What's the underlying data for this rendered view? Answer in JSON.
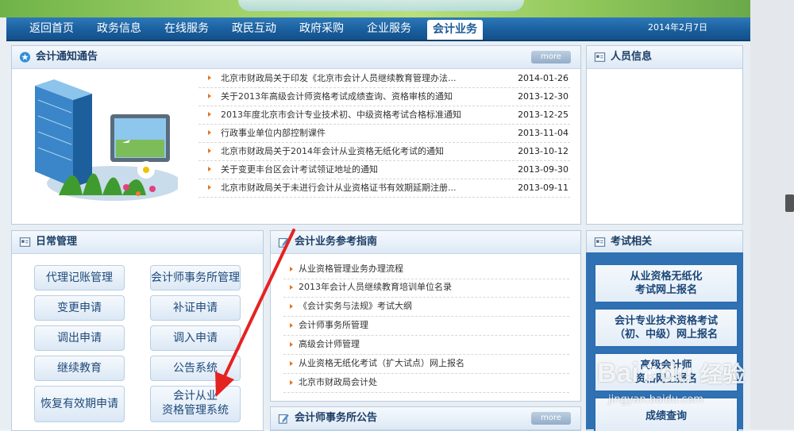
{
  "nav": {
    "items": [
      "返回首页",
      "政务信息",
      "在线服务",
      "政民互动",
      "政府采购",
      "企业服务",
      "会计业务"
    ],
    "active": "会计业务",
    "date": "2014年2月7日"
  },
  "notices": {
    "title": "会计通知通告",
    "more_label": "more",
    "items": [
      {
        "title": "北京市财政局关于印发《北京市会计人员继续教育管理办法...",
        "date": "2014-01-26"
      },
      {
        "title": "关于2013年高级会计师资格考试成绩查询、资格审核的通知",
        "date": "2013-12-30"
      },
      {
        "title": "2013年度北京市会计专业技术初、中级资格考试合格标准通知",
        "date": "2013-12-25"
      },
      {
        "title": "行政事业单位内部控制课件",
        "date": "2013-11-04"
      },
      {
        "title": "北京市财政局关于2014年会计从业资格无纸化考试的通知",
        "date": "2013-10-12"
      },
      {
        "title": "关于变更丰台区会计考试领证地址的通知",
        "date": "2013-09-30"
      },
      {
        "title": "北京市财政局关于未进行会计从业资格证书有效期延期注册...",
        "date": "2013-09-11"
      }
    ]
  },
  "personnel": {
    "title": "人员信息"
  },
  "daily": {
    "title": "日常管理",
    "buttons": [
      "代理记账管理",
      "会计师事务所管理",
      "变更申请",
      "补证申请",
      "调出申请",
      "调入申请",
      "继续教育",
      "公告系统",
      "恢复有效期申请",
      "会计从业",
      "资格管理系统"
    ]
  },
  "guide": {
    "title": "会计业务参考指南",
    "items": [
      "从业资格管理业务办理流程",
      "2013年会计人员继续教育培训单位名录",
      "《会计实务与法规》考试大纲",
      "会计师事务所管理",
      "高级会计师管理",
      "从业资格无纸化考试（扩大试点）网上报名",
      "北京市财政局会计处"
    ]
  },
  "firm_notices": {
    "title": "会计师事务所公告",
    "more_label": "more"
  },
  "exam": {
    "title": "考试相关",
    "blocks": [
      {
        "line1": "从业资格无纸化",
        "line2": "考试网上报名"
      },
      {
        "line1": "会计专业技术资格考试",
        "line2": "（初、中级）网上报名"
      },
      {
        "line1": "高级会计师",
        "line2": "资格网上报名"
      },
      {
        "line1": "成绩查询",
        "line2": ""
      }
    ]
  },
  "watermark": {
    "brand": "Bai",
    "brand2": "du",
    "text": "经验",
    "url": "jingyan.baidu.com"
  },
  "colors": {
    "nav_blue": "#1a5f9f",
    "annotation_red": "#e52222",
    "bullet_orange": "#e6731a"
  }
}
